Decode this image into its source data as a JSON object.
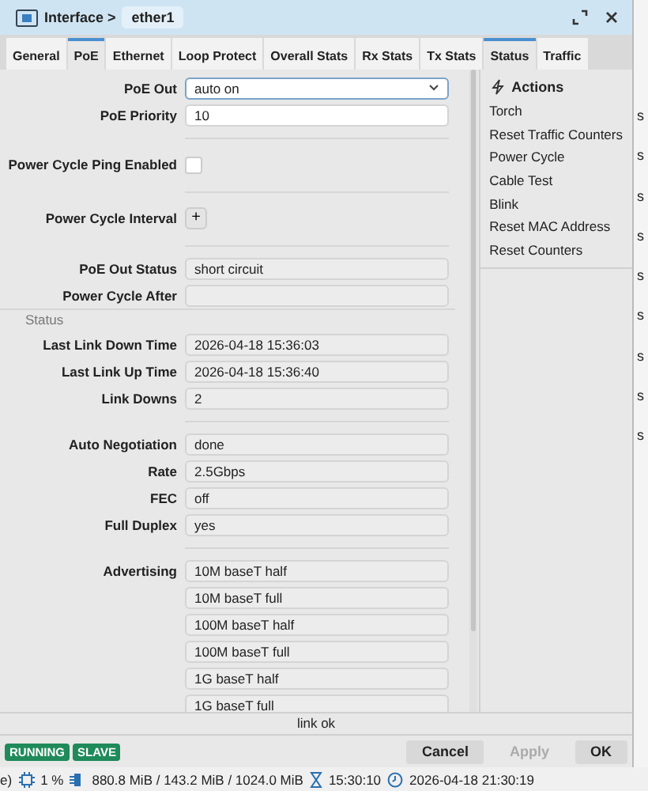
{
  "window": {
    "title": "Interface >",
    "name": "ether1"
  },
  "tabs": [
    {
      "label": "General",
      "selected": false
    },
    {
      "label": "PoE",
      "selected": true
    },
    {
      "label": "Ethernet",
      "selected": false
    },
    {
      "label": "Loop Protect",
      "selected": false
    },
    {
      "label": "Overall Stats",
      "selected": false
    },
    {
      "label": "Rx Stats",
      "selected": false
    },
    {
      "label": "Tx Stats",
      "selected": false
    },
    {
      "label": "Status",
      "selected": true
    },
    {
      "label": "Traffic",
      "selected": false
    }
  ],
  "fields": [
    {
      "kind": "select",
      "label": "PoE Out",
      "value": "auto on"
    },
    {
      "kind": "input",
      "label": "PoE Priority",
      "value": "10"
    },
    {
      "kind": "divider"
    },
    {
      "kind": "checkbox",
      "label": "Power Cycle Ping Enabled",
      "checked": false
    },
    {
      "kind": "divider"
    },
    {
      "kind": "add",
      "label": "Power Cycle Interval",
      "button": "+"
    },
    {
      "kind": "divider"
    },
    {
      "kind": "readonly",
      "label": "PoE Out Status",
      "value": "short circuit"
    },
    {
      "kind": "readonly",
      "label": "Power Cycle After"
    },
    {
      "kind": "heading",
      "label": "Status"
    },
    {
      "kind": "readonly",
      "label": "Last Link Down Time",
      "value": "2026-04-18 15:36:03"
    },
    {
      "kind": "readonly",
      "label": "Last Link Up Time",
      "value": "2026-04-18 15:36:40"
    },
    {
      "kind": "readonly",
      "label": "Link Downs",
      "value": "2"
    },
    {
      "kind": "divider"
    },
    {
      "kind": "readonly",
      "label": "Auto Negotiation",
      "value": "done"
    },
    {
      "kind": "readonly",
      "label": "Rate",
      "value": "2.5Gbps"
    },
    {
      "kind": "readonly",
      "label": "FEC",
      "value": "off"
    },
    {
      "kind": "readonly",
      "label": "Full Duplex",
      "value": "yes"
    },
    {
      "kind": "divider"
    },
    {
      "kind": "list",
      "label": "Advertising",
      "values": [
        "10M baseT half",
        "10M baseT full",
        "100M baseT half",
        "100M baseT full",
        "1G baseT half",
        "1G baseT full"
      ]
    }
  ],
  "actions": {
    "title": "Actions",
    "items": [
      "Torch",
      "Reset Traffic Counters",
      "Power Cycle",
      "Cable Test",
      "Blink",
      "Reset MAC Address",
      "Reset Counters"
    ]
  },
  "background_fragments": [
    "s",
    "s",
    "s",
    "s",
    "s",
    "s",
    "s",
    "s",
    "s"
  ],
  "status_line": "link ok",
  "badges": [
    "RUNNING",
    "SLAVE"
  ],
  "buttons": [
    {
      "label": "Cancel",
      "disabled": false
    },
    {
      "label": "Apply",
      "disabled": true
    },
    {
      "label": "OK",
      "disabled": false
    }
  ],
  "taskbar": {
    "fragment": "e)",
    "cpu": "1 %",
    "memory": "880.8 MiB / 143.2 MiB / 1024.0 MiB",
    "uptime": "15:30:10",
    "clock": "2026-04-18 21:30:19"
  }
}
